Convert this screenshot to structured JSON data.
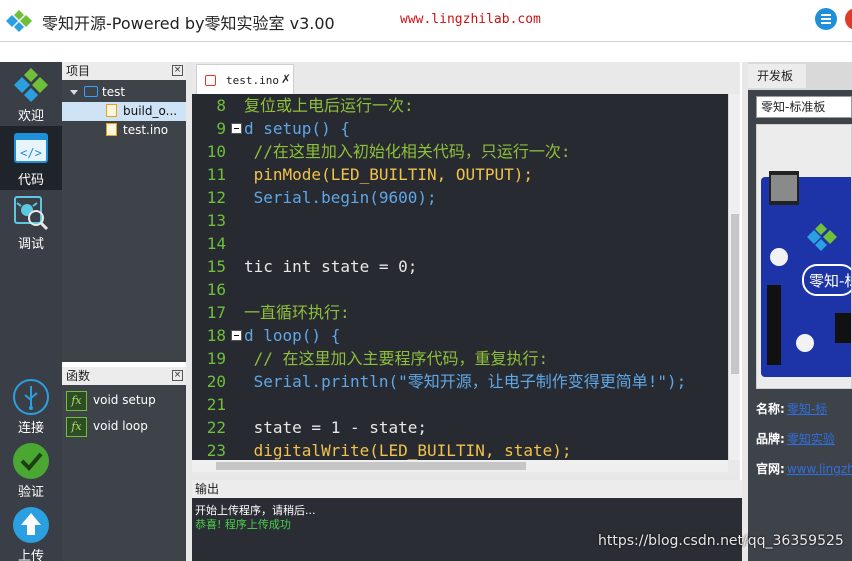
{
  "title_bar": {
    "app_title": "零知开源-Powered by零知实验室 v3.00",
    "website": "www.lingzhilab.com",
    "menu_icon": "list-menu-icon",
    "close_icon": "close-icon"
  },
  "left_nav": {
    "items": [
      {
        "label": "欢迎",
        "icon": "logo-icon"
      },
      {
        "label": "代码",
        "icon": "code-icon"
      },
      {
        "label": "调试",
        "icon": "debug-icon"
      },
      {
        "label": "连接",
        "icon": "usb-icon"
      },
      {
        "label": "验证",
        "icon": "check-icon"
      },
      {
        "label": "上传",
        "icon": "upload-icon"
      }
    ]
  },
  "project_panel": {
    "title": "项目",
    "tree": {
      "root": "test",
      "files": [
        "build_o...",
        "test.ino"
      ]
    }
  },
  "functions_panel": {
    "title": "函数",
    "items": [
      "void setup",
      "void loop"
    ]
  },
  "editor": {
    "tab_label": "test.ino",
    "lines": [
      {
        "num": "8",
        "text": "复位或上电后运行一次:"
      },
      {
        "num": "9",
        "text": "d setup() {"
      },
      {
        "num": "10",
        "text": " //在这里加入初始化相关代码，只运行一次:"
      },
      {
        "num": "11",
        "text": " pinMode(LED_BUILTIN, OUTPUT);"
      },
      {
        "num": "12",
        "text": " Serial.begin(9600);"
      },
      {
        "num": "13",
        "text": ""
      },
      {
        "num": "14",
        "text": ""
      },
      {
        "num": "15",
        "text": "tic int state = 0;"
      },
      {
        "num": "16",
        "text": ""
      },
      {
        "num": "17",
        "text": "一直循环执行:"
      },
      {
        "num": "18",
        "text": "d loop() {"
      },
      {
        "num": "19",
        "text": " // 在这里加入主要程序代码，重复执行:"
      },
      {
        "num": "20",
        "text": " Serial.println(\"零知开源，让电子制作变得更简单!\");"
      },
      {
        "num": "21",
        "text": ""
      },
      {
        "num": "22",
        "text": " state = 1 - state;"
      },
      {
        "num": "23",
        "text": " digitalWrite(LED_BUILTIN, state);"
      }
    ]
  },
  "output_panel": {
    "title": "输出",
    "lines": [
      {
        "text": "开始上传程序，请稍后...",
        "color": "#ffffff"
      },
      {
        "text": "恭喜! 程序上传成功",
        "color": "#4ad04a"
      }
    ]
  },
  "board_panel": {
    "tab": "开发板",
    "selected_board": "零知-标准板",
    "board_image_text": "零知-标",
    "info": [
      {
        "key": "名称:",
        "value": "零知-标"
      },
      {
        "key": "品牌:",
        "value": "零知实验"
      },
      {
        "key": "官网:",
        "value": "www.lingzh"
      }
    ]
  },
  "watermark": "https://blog.csdn.net/qq_36359525",
  "colors": {
    "accent_blue": "#1e8fd8",
    "comment_green": "#8fbf3a",
    "keyword_blue": "#5fa7e6",
    "function_yellow": "#f2c24a",
    "number_orange": "#e86a3a"
  }
}
